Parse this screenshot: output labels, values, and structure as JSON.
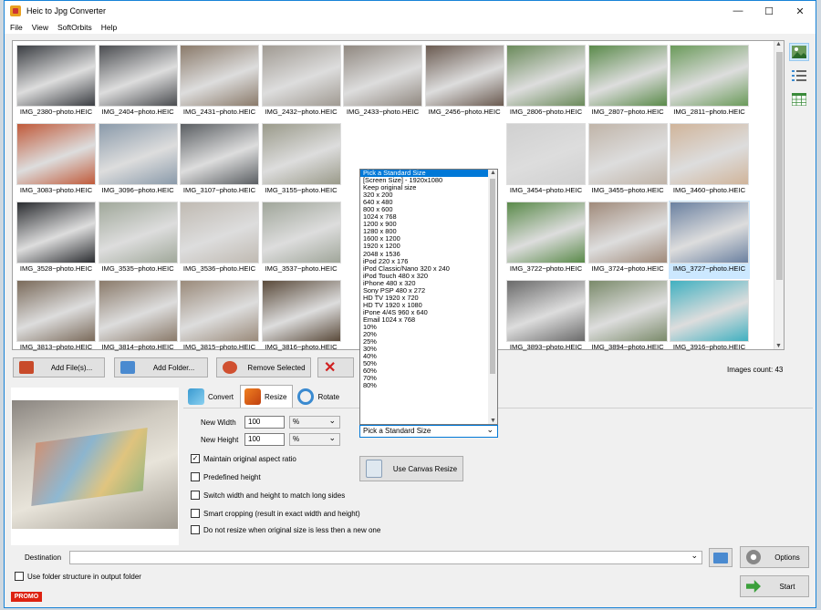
{
  "window": {
    "title": "Heic to Jpg Converter",
    "minimize": "—",
    "maximize": "☐",
    "close": "✕"
  },
  "menu": [
    "File",
    "View",
    "SoftOrbits",
    "Help"
  ],
  "thumbnails": [
    [
      "IMG_2380~photo.HEIC",
      "IMG_2404~photo.HEIC",
      "IMG_2431~photo.HEIC",
      "IMG_2432~photo.HEIC",
      "IMG_2433~photo.HEIC",
      "IMG_2456~photo.HEIC",
      "IMG_2806~photo.HEIC",
      "IMG_2807~photo.HEIC",
      "IMG_2811~photo.HEIC"
    ],
    [
      "IMG_3083~photo.HEIC",
      "IMG_3096~photo.HEIC",
      "IMG_3107~photo.HEIC",
      "IMG_3155~photo.HEIC",
      "",
      "",
      "IMG_3454~photo.HEIC",
      "IMG_3455~photo.HEIC",
      "IMG_3460~photo.HEIC"
    ],
    [
      "IMG_3528~photo.HEIC",
      "IMG_3535~photo.HEIC",
      "IMG_3536~photo.HEIC",
      "IMG_3537~photo.HEIC",
      "",
      "",
      "IMG_3722~photo.HEIC",
      "IMG_3724~photo.HEIC",
      "IMG_3727~photo.HEIC"
    ],
    [
      "IMG_3813~photo.HEIC",
      "IMG_3814~photo.HEIC",
      "IMG_3815~photo.HEIC",
      "IMG_3816~photo.HEIC",
      "",
      "",
      "IMG_3893~photo.HEIC",
      "IMG_3894~photo.HEIC",
      "IMG_3916~photo.HEIC"
    ]
  ],
  "thumb_colors": [
    [
      "#3a3d42",
      "#4a4c50",
      "#8a7a6a",
      "#a09a92",
      "#908880",
      "#6a5a50",
      "#6a8a5a",
      "#5a8a4a",
      "#6a9a5a"
    ],
    [
      "#c05a3a",
      "#8a9aaa",
      "#5a5e62",
      "#9a9a8a",
      "",
      "",
      "#d0d0d0",
      "#c0b4a8",
      "#d0b49a"
    ],
    [
      "#2a2c30",
      "#a0a89a",
      "#c0bab2",
      "#a0a69a",
      "",
      "",
      "#5a8a4a",
      "#a08a7a",
      "#6a80a0"
    ],
    [
      "#7a6a5a",
      "#8a7a6a",
      "#9a8a7a",
      "#5a4a3a",
      "",
      "",
      "#6a6a6a",
      "#7a8a6a",
      "#40b0c0"
    ]
  ],
  "selected_thumb": "IMG_3727~photo.HEIC",
  "buttons": {
    "add_files": "Add File(s)...",
    "add_folder": "Add Folder...",
    "remove_selected": "Remove Selected",
    "options": "Options",
    "start": "Start",
    "canvas_resize": "Use Canvas Resize"
  },
  "images_count": "Images count: 43",
  "tabs": {
    "convert": "Convert",
    "resize": "Resize",
    "rotate": "Rotate"
  },
  "resize": {
    "new_width_label": "New Width",
    "new_width": "100",
    "width_unit": "%",
    "new_height_label": "New Height",
    "new_height": "100",
    "height_unit": "%",
    "maintain": "Maintain original aspect ratio",
    "predefined": "Predefined height",
    "switch": "Switch width and height to match long sides",
    "smart": "Smart cropping (result in exact width and height)",
    "noresize": "Do not resize when original size is less then a new one"
  },
  "size_dropdown": {
    "selected": "Pick a Standard Size",
    "items": [
      "Pick a Standard Size",
      "[Screen Size] - 1920x1080",
      "Keep original size",
      "320 x 200",
      "640 x 480",
      "800 x 600",
      "1024 x 768",
      "1200 x 900",
      "1280 x 800",
      "1600 x 1200",
      "1920 x 1200",
      "2048 x 1536",
      "iPod 220 x 176",
      "iPod Classic/Nano 320 x 240",
      "iPod Touch 480 x 320",
      "iPhone 480 x 320",
      "Sony PSP 480 x 272",
      "HD TV 1920 x 720",
      "HD TV 1920 x 1080",
      "iPone 4/4S 960 x 640",
      "Email 1024 x 768",
      "10%",
      "20%",
      "25%",
      "30%",
      "40%",
      "50%",
      "60%",
      "70%",
      "80%"
    ]
  },
  "destination": {
    "label": "Destination",
    "value": ""
  },
  "folder_structure": "Use folder structure in output folder",
  "promo": "PROMO"
}
